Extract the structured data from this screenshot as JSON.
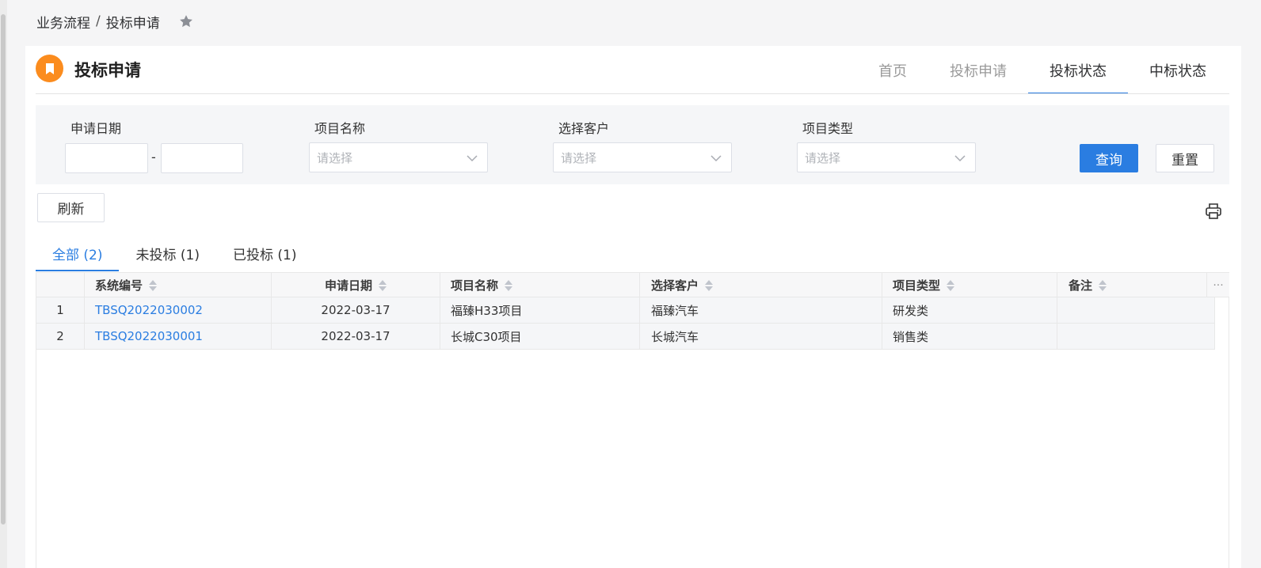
{
  "breadcrumb": {
    "parent": "业务流程",
    "separator": "/",
    "current": "投标申请"
  },
  "header": {
    "title": "投标申请"
  },
  "nav": {
    "items": [
      "首页",
      "投标申请",
      "投标状态",
      "中标状态"
    ],
    "active": "投标状态"
  },
  "filters": {
    "date_label": "申请日期",
    "date_separator": "-",
    "project_name_label": "项目名称",
    "project_name_placeholder": "请选择",
    "customer_label": "选择客户",
    "customer_placeholder": "请选择",
    "project_type_label": "项目类型",
    "project_type_placeholder": "请选择",
    "query_button": "查询",
    "reset_button": "重置"
  },
  "toolbar": {
    "refresh_button": "刷新"
  },
  "tabs": [
    {
      "label": "全部 (2)",
      "active": true
    },
    {
      "label": "未投标 (1)",
      "active": false
    },
    {
      "label": "已投标 (1)",
      "active": false
    }
  ],
  "table": {
    "columns": [
      "系统编号",
      "申请日期",
      "项目名称",
      "选择客户",
      "项目类型",
      "备注"
    ],
    "rows": [
      {
        "index": "1",
        "code": "TBSQ2022030002",
        "date": "2022-03-17",
        "project": "福臻H33项目",
        "customer": "福臻汽车",
        "type": "研发类",
        "remark": ""
      },
      {
        "index": "2",
        "code": "TBSQ2022030001",
        "date": "2022-03-17",
        "project": "长城C30项目",
        "customer": "长城汽车",
        "type": "销售类",
        "remark": ""
      }
    ],
    "more_icon": "···"
  },
  "colors": {
    "accent": "#2a7de1",
    "logo": "#fb8c1e"
  },
  "icons": {
    "favorite": "star-icon",
    "logo": "bookmark-icon",
    "print": "printer-icon",
    "dropdown": "chevron-down-icon"
  }
}
